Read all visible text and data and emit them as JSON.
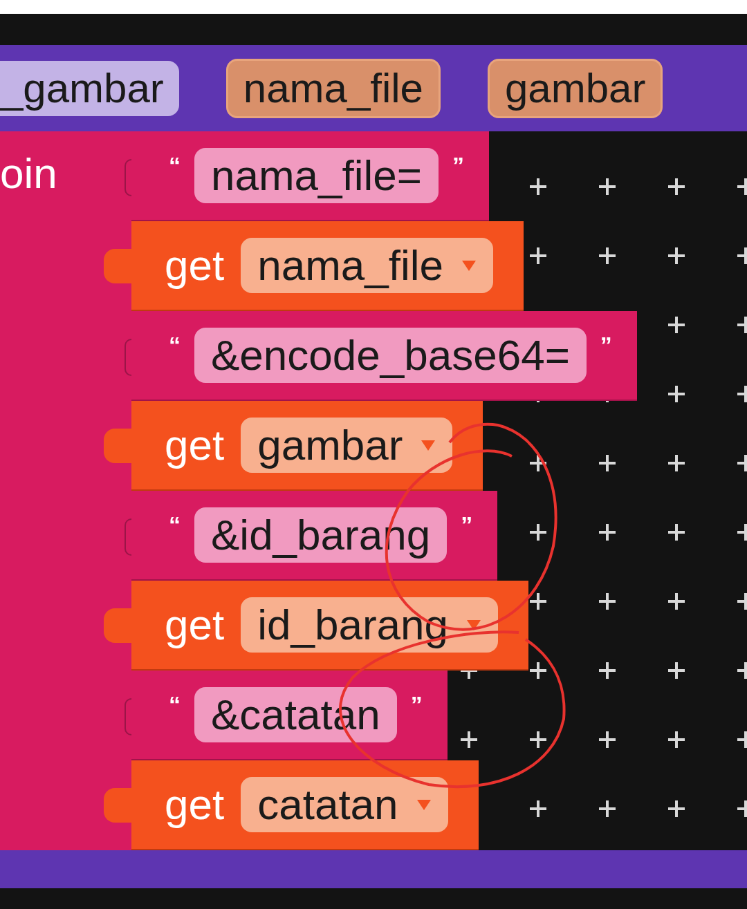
{
  "parameters": [
    {
      "label": "_gambar",
      "kind": "procedure"
    },
    {
      "label": "nama_file",
      "kind": "local"
    },
    {
      "label": "gambar",
      "kind": "local"
    }
  ],
  "join": {
    "label": "oin"
  },
  "items": [
    {
      "kind": "text",
      "open_quote": "“",
      "value": "nama_file=",
      "close_quote": "”"
    },
    {
      "kind": "get",
      "keyword": "get",
      "variable": "nama_file"
    },
    {
      "kind": "text",
      "open_quote": "“",
      "value": "&encode_base64=",
      "close_quote": "”"
    },
    {
      "kind": "get",
      "keyword": "get",
      "variable": "gambar"
    },
    {
      "kind": "text",
      "open_quote": "“",
      "value": "&id_barang",
      "close_quote": "”"
    },
    {
      "kind": "get",
      "keyword": "get",
      "variable": "id_barang"
    },
    {
      "kind": "text",
      "open_quote": "“",
      "value": "&catatan",
      "close_quote": "”"
    },
    {
      "kind": "get",
      "keyword": "get",
      "variable": "catatan"
    }
  ]
}
